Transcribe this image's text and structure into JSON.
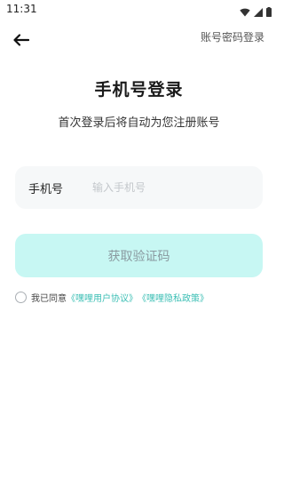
{
  "status_bar": {
    "time": "11:31",
    "icons": [
      "wifi-icon",
      "signal-icon",
      "battery-icon"
    ]
  },
  "nav": {
    "back_icon": "arrow-left-icon",
    "switch_login": "账号密码登录"
  },
  "page": {
    "title": "手机号登录",
    "subtitle": "首次登录后将自动为您注册账号"
  },
  "phone_field": {
    "label": "手机号",
    "placeholder": "输入手机号",
    "value": ""
  },
  "code_button": {
    "label": "获取验证码"
  },
  "agreement": {
    "checked": false,
    "prefix": "我已同意",
    "user_agreement": "《嘿哩用户协议》",
    "privacy_policy": "《嘿哩隐私政策》"
  },
  "colors": {
    "accent": "#3cbfb5",
    "button_bg": "#c7f7f3",
    "input_bg": "#f6f8f9"
  }
}
